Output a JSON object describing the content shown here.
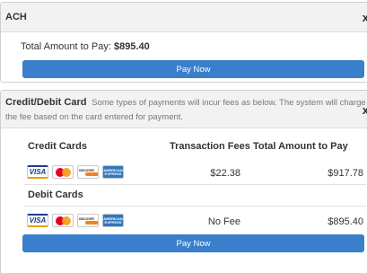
{
  "ach": {
    "title": "ACH",
    "close": "x",
    "total_label": "Total Amount to Pay: ",
    "total_value": "$895.40",
    "pay_button": "Pay Now"
  },
  "card": {
    "title": "Credit/Debit Card",
    "description_line1": "Some types of payments will incur fees as below. The system will charge",
    "description_line2": "the fee based on the card entered for payment.",
    "close": "x",
    "columns": {
      "credit_cards": "Credit Cards",
      "transaction_fees": "Transaction Fees",
      "total_amount": "Total Amount to Pay"
    },
    "credit_row": {
      "fee": "$22.38",
      "total": "$917.78"
    },
    "debit_title": "Debit Cards",
    "debit_row": {
      "fee": "No Fee",
      "total": "$895.40"
    },
    "pay_button": "Pay Now"
  },
  "logos": {
    "visa": "VISA",
    "discover": "DISCOVER",
    "amex": "AMERICAN EXPRESS"
  },
  "colors": {
    "pay_button": "#3a7fcb",
    "header_bg": "#f2f2f2"
  }
}
